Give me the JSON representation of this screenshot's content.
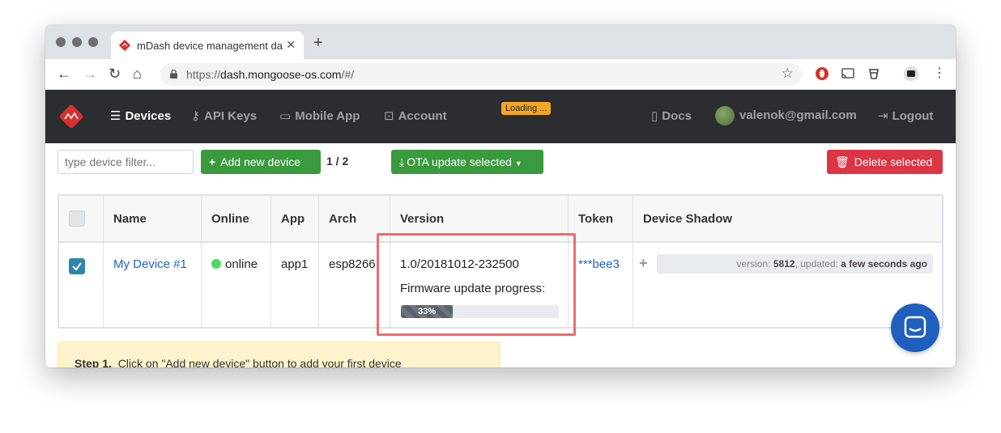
{
  "browser": {
    "tab_title": "mDash device management da",
    "tab_close": "✕",
    "new_tab": "+",
    "url_scheme": "https://",
    "url_host": "dash.mongoose-os.com",
    "url_path": "/#/"
  },
  "nav": {
    "devices": "Devices",
    "api_keys": "API Keys",
    "mobile_app": "Mobile App",
    "account": "Account",
    "loading": "Loading ...",
    "docs": "Docs",
    "user": "valenok@gmail.com",
    "logout": "Logout"
  },
  "controls": {
    "filter_placeholder": "type device filter...",
    "add_device": "Add new device",
    "count": "1 / 2",
    "ota": "OTA update selected",
    "delete": "Delete selected"
  },
  "table": {
    "headers": [
      "Name",
      "Online",
      "App",
      "Arch",
      "Version",
      "Token",
      "Device Shadow"
    ],
    "rows": [
      {
        "name": "My Device #1",
        "online": "online",
        "app": "app1",
        "arch": "esp8266",
        "version": "1.0/20181012-232500",
        "progress_label": "Firmware update progress:",
        "progress": 33,
        "progress_text": "33%",
        "token": "***bee3",
        "shadow_version_label": "version:",
        "shadow_version": "5812",
        "shadow_updated_label": ", updated:",
        "shadow_updated": "a few seconds ago"
      }
    ]
  },
  "step": {
    "label": "Step 1.",
    "text": "Click on \"Add new device\" button to add your first device"
  },
  "colors": {
    "brand_red": "#dc3545",
    "green": "#3a9a3e",
    "header_bg": "#2b2d30",
    "link": "#1e64c8",
    "online": "#4cd964",
    "highlight": "#ee6b6b"
  }
}
